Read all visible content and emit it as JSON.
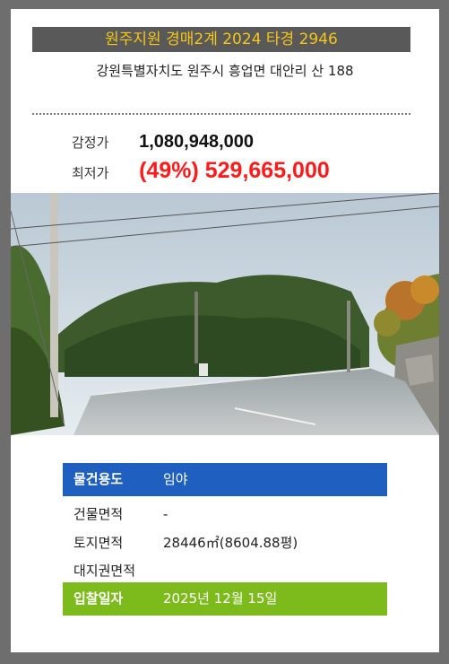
{
  "header": {
    "title": "원주지원 경매2계 2024 타경 2946",
    "address": "강원특별자치도 원주시 흥업면 대안리 산 188"
  },
  "prices": {
    "appraisal_label": "감정가",
    "appraisal_value": "1,080,948,000",
    "minimum_label": "최저가",
    "minimum_value": "(49%) 529,665,000"
  },
  "details": {
    "usage_label": "물건용도",
    "usage_value": "임야",
    "building_area_label": "건물면적",
    "building_area_value": "-",
    "land_area_label": "토지면적",
    "land_area_value": "28446㎡(8604.88평)",
    "land_right_label": "대지권면적",
    "land_right_value": "",
    "bid_date_label": "입찰일자",
    "bid_date_value": "2025년 12월 15일"
  },
  "colors": {
    "title_bg": "#595959",
    "title_text": "#f5c518",
    "minimum_price": "#ff1a1a",
    "usage_row_bg": "#1f5fc0",
    "bid_row_bg": "#7dbb1c"
  }
}
